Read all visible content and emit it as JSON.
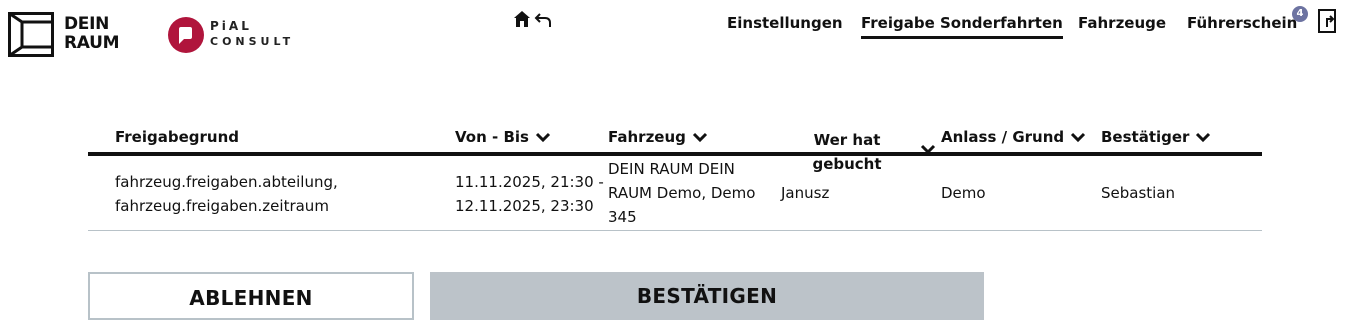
{
  "brand": {
    "logo_line1": "DEIN",
    "logo_line2": "RAUM",
    "partner_line1": "PiAL",
    "partner_line2": "CONSULT"
  },
  "nav": {
    "items": [
      {
        "label": "Einstellungen"
      },
      {
        "label": "Freigabe Sonderfahrten"
      },
      {
        "label": "Fahrzeuge"
      },
      {
        "label": "Führerschein"
      }
    ],
    "active_index": 1,
    "license_badge": "4"
  },
  "table": {
    "columns": [
      "Freigabegrund",
      "Von - Bis",
      "Fahrzeug",
      "Wer hat gebucht",
      "Anlass / Grund",
      "Bestätiger"
    ],
    "wer_line1": "Wer hat",
    "wer_line2": "gebucht",
    "rows": [
      {
        "grund_line1": "fahrzeug.freigaben.abteilung,",
        "grund_line2": "fahrzeug.freigaben.zeitraum",
        "von_bis_line1": "11.11.2025, 21:30 -",
        "von_bis_line2": "12.11.2025, 23:30",
        "fahrzeug_line1": "DEIN RAUM DEIN",
        "fahrzeug_line2": "RAUM Demo, Demo",
        "fahrzeug_line3": "345",
        "gebucht_von": "Janusz",
        "anlass": "Demo",
        "bestaetiger": "Sebastian"
      }
    ]
  },
  "actions": {
    "reject_label": "ABLEHNEN",
    "confirm_label": "BESTÄTIGEN"
  },
  "colors": {
    "accent_dark": "#111111",
    "badge": "#6d73a1",
    "brand_red": "#b0153c",
    "confirm_bg": "#bcc3c9",
    "divider": "#b8c2c8"
  },
  "icons": [
    "home-icon",
    "back-arrow-icon",
    "logout-icon",
    "chevron-down-icon"
  ]
}
